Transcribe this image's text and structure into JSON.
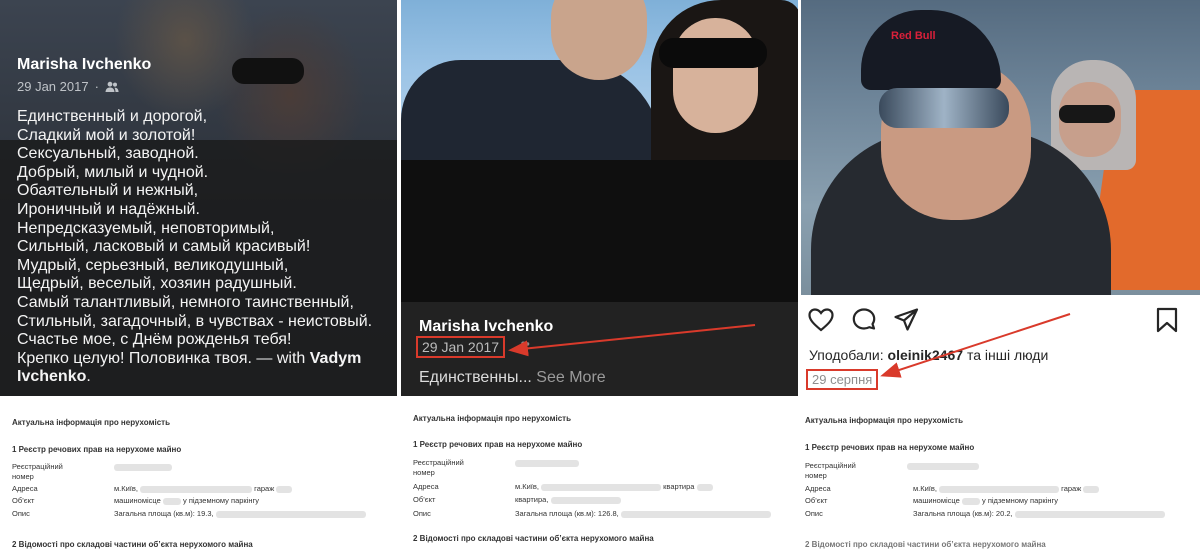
{
  "panel1": {
    "name": "Marisha Ivchenko",
    "date": "29 Jan 2017",
    "poem_lines": [
      "Единственный и дорогой,",
      "Сладкий мой и золотой!",
      "Сексуальный, заводной.",
      "Добрый, милый и чудной.",
      "Обаятельный и нежный,",
      "Ироничный и надёжный.",
      "Непредсказуемый, неповторимый,",
      "Сильный, ласковый и самый красивый!",
      "Мудрый, серьезный, великодушный,",
      "Щедрый, веселый, хозяин радушный.",
      "Самый талантливый, немного таинственный,",
      "Стильный, загадочный, в чувствах - неистовый.",
      "Счастье мое, с Днём рожденья тебя!"
    ],
    "closing_prefix": "Крепко целую! Половинка твоя. — with ",
    "tagged_name_1": "Vadym",
    "tagged_name_2": "Ivchenko",
    "closing_suffix": "."
  },
  "panel2": {
    "name": "Marisha Ivchenko",
    "date": "29 Jan 2017",
    "snippet": "Единственны...",
    "see_more": "See More"
  },
  "panel3": {
    "cap_brand": "Red Bull",
    "likes_prefix": "Уподобали:",
    "likes_user": "oleinik2467",
    "likes_suffix": "та інші люди",
    "date": "29 серпня"
  },
  "documents": [
    {
      "title": "Актуальна інформація про нерухомість",
      "section1": "1 Реєстр речових прав на нерухоме майно",
      "reg_label": "Реєстраційний номер",
      "address_label": "Адреса",
      "address_city": "м.Київ,",
      "address_type": "гараж",
      "object_label": "Об’єкт",
      "object_value_prefix": "машиномісце",
      "object_value_suffix": "у підземному паркінгу",
      "desc_label": "Опис",
      "desc_value": "Загальна площа (кв.м): 19.3,",
      "section2": "2 Відомості про складові частини об’єкта нерухомого майна"
    },
    {
      "title": "Актуальна інформація про нерухомість",
      "section1": "1 Реєстр речових прав на нерухоме майно",
      "reg_label": "Реєстраційний номер",
      "address_label": "Адреса",
      "address_city": "м.Київ,",
      "address_type": "квартира",
      "object_label": "Об’єкт",
      "object_value_prefix": "квартира,",
      "object_value_suffix": "",
      "desc_label": "Опис",
      "desc_value": "Загальна площа (кв.м): 126.8,",
      "section2": "2 Відомості про складові частини об’єкта нерухомого майна"
    },
    {
      "title": "Актуальна інформація про нерухомість",
      "section1": "1 Реєстр речових прав на нерухоме майно",
      "reg_label": "Реєстраційний номер",
      "address_label": "Адреса",
      "address_city": "м.Київ,",
      "address_type": "гараж",
      "object_label": "Об’єкт",
      "object_value_prefix": "машиномісце",
      "object_value_suffix": "у підземному паркінгу",
      "desc_label": "Опис",
      "desc_value": "Загальна площа (кв.м): 20.2,",
      "section2": "2 Відомості про складові частини об’єкта нерухомого майна"
    }
  ],
  "colors": {
    "highlight": "#d93a2b",
    "arrow": "#d93a2b"
  }
}
